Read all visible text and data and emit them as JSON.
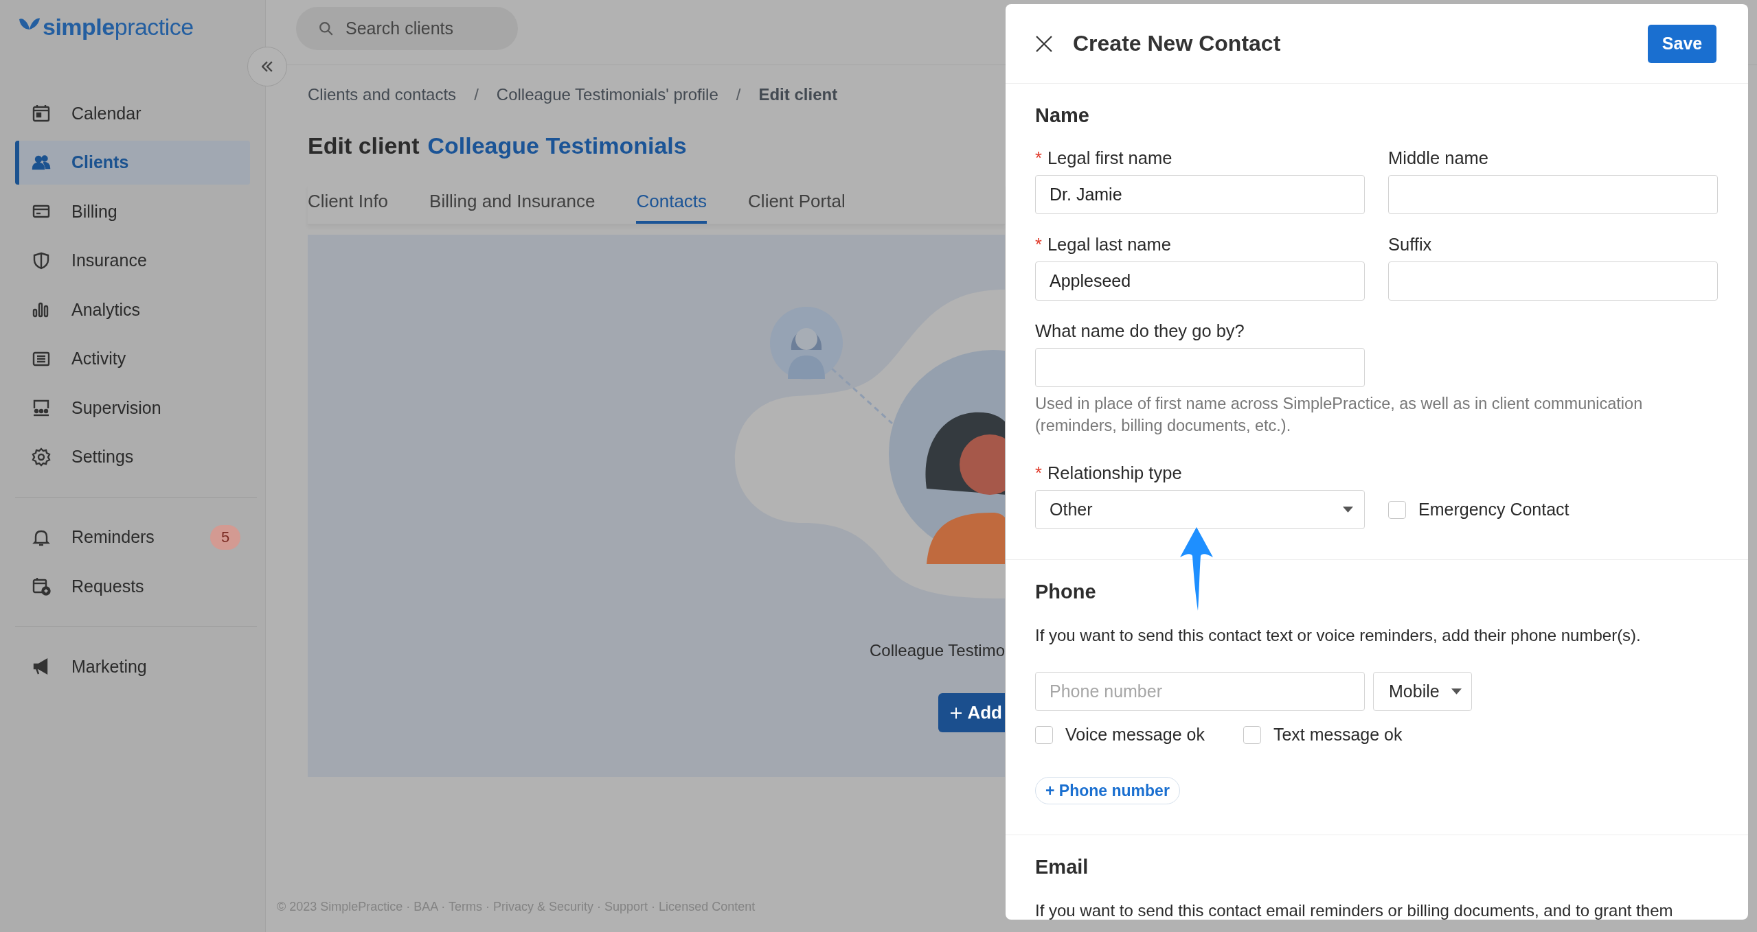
{
  "sidebar": {
    "logo": "**simple**practice",
    "sections": [
      {
        "items": [
          {
            "label": "Calendar",
            "kind": "calendar",
            "selected": false
          },
          {
            "label": "Clients",
            "kind": "clients",
            "selected": true
          },
          {
            "label": "Billing",
            "kind": "billing",
            "selected": false
          },
          {
            "label": "Insurance",
            "kind": "insurance",
            "selected": false
          },
          {
            "label": "Analytics",
            "kind": "analytics",
            "selected": false
          },
          {
            "label": "Activity",
            "kind": "activity",
            "selected": false
          },
          {
            "label": "Supervision",
            "kind": "supervision",
            "selected": false
          },
          {
            "label": "Settings",
            "kind": "settings",
            "selected": false
          }
        ]
      },
      {
        "items": [
          {
            "label": "Reminders",
            "kind": "reminders",
            "selected": false,
            "badge": "5"
          },
          {
            "label": "Requests",
            "kind": "requests",
            "selected": false
          }
        ]
      },
      {
        "items": [
          {
            "label": "Marketing",
            "kind": "marketing",
            "selected": false
          }
        ]
      }
    ]
  },
  "search": {
    "placeholder": "Search clients"
  },
  "breadcrumb": [
    {
      "label": "Clients and contacts",
      "current": false
    },
    {
      "label": "/",
      "kind": "separator"
    },
    {
      "label": "Colleague Testimonials' profile",
      "current": false
    },
    {
      "label": "/",
      "kind": "separator"
    },
    {
      "label": "Edit client",
      "current": true
    }
  ],
  "heading": {
    "prefix": "Edit client",
    "client_name": "Colleague Testimonials"
  },
  "tabs": [
    {
      "label": "Client Info",
      "selected": false
    },
    {
      "label": "Billing and Insurance",
      "selected": false
    },
    {
      "label": "Contacts",
      "selected": true
    },
    {
      "label": "Client Portal",
      "selected": false
    }
  ],
  "contacts_card": {
    "caption": "Colleague Testimo",
    "add_button": "Add"
  },
  "footer": "© 2023 SimplePractice · BAA · Terms · Privacy & Security · Support · Licensed Content",
  "dialog": {
    "title": "Create New Contact",
    "save_button": "Save",
    "name_section": {
      "heading": "Name",
      "fields": [
        {
          "label": "Legal first name",
          "required_mark": "*",
          "value": "Dr. Jamie"
        },
        {
          "label": "Middle name"
        },
        {
          "label": "Legal last name",
          "required_mark": "*",
          "value": "Appleseed"
        },
        {
          "label": "Suffix"
        }
      ],
      "nickname": {
        "label": "What name do they go by?",
        "hint": "Used in place of first name across SimplePractice, as well as in client communication (reminders, billing documents, etc.)."
      },
      "relationship": {
        "label": "Relationship type",
        "required_mark": "*",
        "value": "Other"
      },
      "emergency_contact": {
        "label": "Emergency Contact",
        "checked": false
      }
    },
    "phone_section": {
      "heading": "Phone",
      "description": "If you want to send this contact text or voice reminders, add their phone number(s).",
      "number": {
        "placeholder": "Phone number"
      },
      "type": "Mobile",
      "options": [
        {
          "label": "Voice message ok",
          "checked": false
        },
        {
          "label": "Text message ok",
          "checked": false
        }
      ],
      "add_button": "+ Phone number"
    },
    "email_section": {
      "heading": "Email",
      "description": "If you want to send this contact email reminders or billing documents, and to grant them"
    }
  }
}
